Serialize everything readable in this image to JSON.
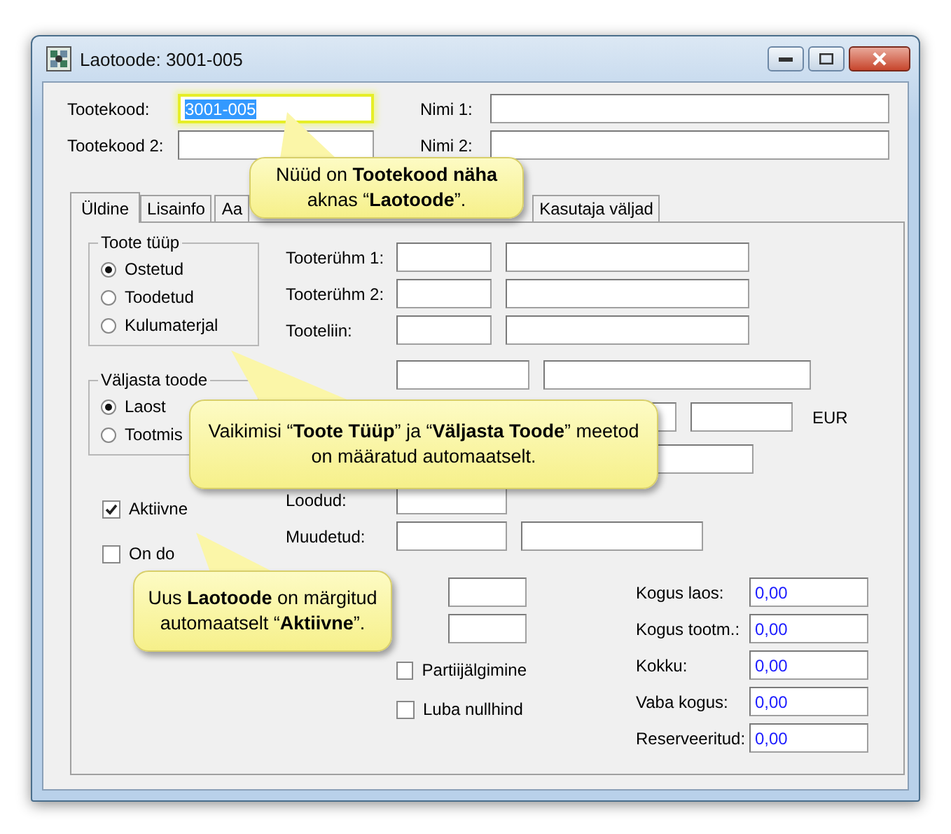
{
  "window": {
    "title": "Laotoode: 3001-005"
  },
  "header_fields": [
    {
      "label": "Tootekood:",
      "value": "3001-005",
      "focused": true
    },
    {
      "label": "Nimi 1:",
      "focused": false
    },
    {
      "label": "Tootekood 2:",
      "focused": false
    },
    {
      "label": "Nimi 2:",
      "focused": false
    }
  ],
  "tabs": [
    {
      "label": "Üldine",
      "selected": true
    },
    {
      "label": "Lisainfo",
      "selected": false
    },
    {
      "label": "Aa",
      "selected": false
    },
    {
      "label": "Kasutaja väljad",
      "selected": false
    }
  ],
  "groups": [
    {
      "title": "Toote tüüp",
      "options": [
        {
          "label": "Ostetud",
          "selected": true
        },
        {
          "label": "Toodetud",
          "selected": false
        },
        {
          "label": "Kulumaterjal",
          "selected": false
        }
      ]
    },
    {
      "title": "Väljasta toode",
      "options": [
        {
          "label": "Laost",
          "selected": true
        },
        {
          "label": "Tootmis",
          "selected": false
        }
      ]
    }
  ],
  "left_checkboxes": [
    {
      "label": "Aktiivne",
      "checked": true
    },
    {
      "label": "On do",
      "checked": false
    }
  ],
  "rows": [
    {
      "label": "Tooterühm 1:"
    },
    {
      "label": "Tooterühm 2:"
    },
    {
      "label": "Tooteliin:"
    },
    {},
    {
      "suffix": "EUR"
    },
    {},
    {
      "label": "Loodud:"
    },
    {
      "label": "Muudetud:"
    }
  ],
  "middle_checkboxes": [
    {
      "label": "Partiijälgimine",
      "checked": false
    },
    {
      "label": "Luba nullhind",
      "checked": false
    }
  ],
  "quantities": [
    {
      "label": "Kogus laos:",
      "value": "0,00"
    },
    {
      "label": "Kogus tootm.:",
      "value": "0,00"
    },
    {
      "label": "Kokku:",
      "value": "0,00"
    },
    {
      "label": "Vaba kogus:",
      "value": "0,00"
    },
    {
      "label": "Reserveeritud:",
      "value": "0,00"
    }
  ],
  "callouts": [
    {
      "text": "Nüüd on **Tootekood näha** aknas “**Laotoode**”."
    },
    {
      "text": "Vaikimisi “**Toote Tüüp**”  ja “**Väljasta Toode**” meetod on  määratud automaatselt."
    },
    {
      "text": "Uus **Laotoode** on märgitud automaatselt “**Aktiivne**”."
    }
  ]
}
